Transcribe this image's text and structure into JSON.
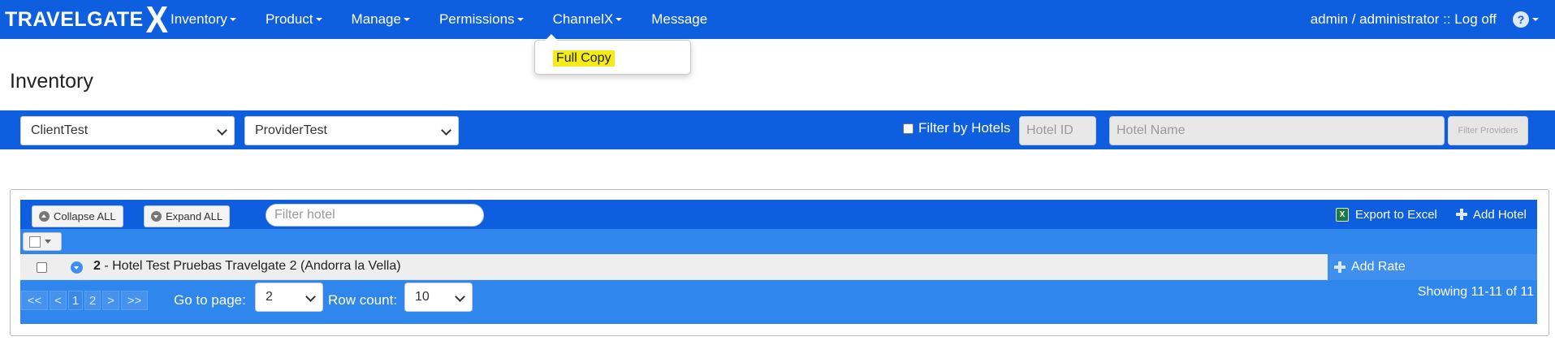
{
  "app": {
    "logo_text": "TRAVELGATE",
    "logo_mark": "X"
  },
  "nav": {
    "items": [
      {
        "label": "Inventory"
      },
      {
        "label": "Product"
      },
      {
        "label": "Manage"
      },
      {
        "label": "Permissions"
      },
      {
        "label": "ChannelX"
      },
      {
        "label": "Message"
      }
    ],
    "user_text": "admin / administrator :: Log off",
    "help_glyph": "?"
  },
  "dropdown": {
    "item": "Full Copy",
    "highlight_color": "#f4ec1a"
  },
  "page": {
    "title": "Inventory"
  },
  "filters": {
    "client_value": "ClientTest",
    "provider_value": "ProviderTest",
    "filter_by_hotels_label": "Filter by Hotels",
    "hotel_id_placeholder": "Hotel ID",
    "hotel_name_placeholder": "Hotel Name",
    "filter_providers_label": "Filter Providers"
  },
  "toolbar": {
    "collapse_all": "Collapse ALL",
    "expand_all": "Expand ALL",
    "filter_hotel_placeholder": "Filter hotel",
    "export_excel": "Export to Excel",
    "add_hotel": "Add Hotel",
    "excel_glyph": "X"
  },
  "rows": [
    {
      "id": "2",
      "text": " - Hotel Test Pruebas Travelgate 2 (Andorra la Vella)",
      "action": "Add Rate"
    }
  ],
  "pager": {
    "first": "<<",
    "prev": "<",
    "pages": [
      "1",
      "2"
    ],
    "next": ">",
    "last": ">>",
    "go_to_label": "Go to page:",
    "go_to_value": "2",
    "row_count_label": "Row count:",
    "row_count_value": "10",
    "showing": "Showing 11-11 of 11"
  },
  "colors": {
    "brand_blue": "#0d5fe0",
    "row_blue": "#2f86ec"
  }
}
